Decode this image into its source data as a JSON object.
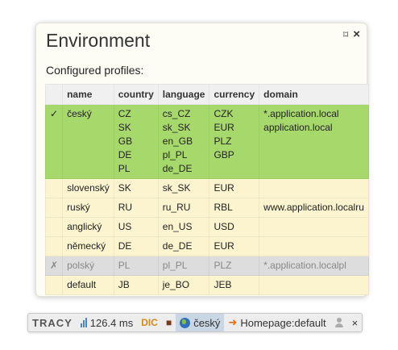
{
  "panel": {
    "title": "Environment",
    "pin_glyph": "⌑",
    "close_glyph": "×",
    "subtitle": "Configured profiles:"
  },
  "table": {
    "headers": [
      "",
      "name",
      "country",
      "language",
      "currency",
      "domain"
    ],
    "rows": [
      {
        "mark": "✓",
        "state": "active",
        "name": "český",
        "country": [
          "CZ",
          "SK",
          "GB",
          "DE",
          "PL"
        ],
        "language": [
          "cs_CZ",
          "sk_SK",
          "en_GB",
          "pl_PL",
          "de_DE"
        ],
        "currency": [
          "CZK",
          "EUR",
          "PLZ",
          "GBP"
        ],
        "domain": [
          "*.application.local",
          "application.local"
        ]
      },
      {
        "mark": "",
        "state": "normal",
        "name": "slovenský",
        "country": [
          "SK"
        ],
        "language": [
          "sk_SK"
        ],
        "currency": [
          "EUR"
        ],
        "domain": []
      },
      {
        "mark": "",
        "state": "normal",
        "name": "ruský",
        "country": [
          "RU"
        ],
        "language": [
          "ru_RU"
        ],
        "currency": [
          "RBL"
        ],
        "domain": [
          "www.application.localru"
        ]
      },
      {
        "mark": "",
        "state": "normal",
        "name": "anglický",
        "country": [
          "US"
        ],
        "language": [
          "en_US"
        ],
        "currency": [
          "USD"
        ],
        "domain": []
      },
      {
        "mark": "",
        "state": "normal",
        "name": "německý",
        "country": [
          "DE"
        ],
        "language": [
          "de_DE"
        ],
        "currency": [
          "EUR"
        ],
        "domain": []
      },
      {
        "mark": "✗",
        "state": "disabled",
        "name": "polský",
        "country": [
          "PL"
        ],
        "language": [
          "pl_PL"
        ],
        "currency": [
          "PLZ"
        ],
        "domain": [
          "*.application.localpl"
        ]
      },
      {
        "mark": "",
        "state": "normal",
        "name": "default",
        "country": [
          "JB"
        ],
        "language": [
          "je_BO"
        ],
        "currency": [
          "JEB"
        ],
        "domain": []
      }
    ]
  },
  "tracy_bar": {
    "logo": "TRACY",
    "time": "126.4 ms",
    "dic": "DIC",
    "profile": "český",
    "route": "Homepage:default",
    "close": "×"
  },
  "colors": {
    "active_row": "#a7d86c",
    "normal_row": "#fbf4cf",
    "disabled_row": "#dddddd",
    "panel_bg": "#fdfdf6"
  },
  "icons": [
    "pin-icon",
    "close-icon",
    "bar-chart-icon",
    "chair-icon",
    "globe-icon",
    "arrow-right-icon",
    "user-icon"
  ]
}
